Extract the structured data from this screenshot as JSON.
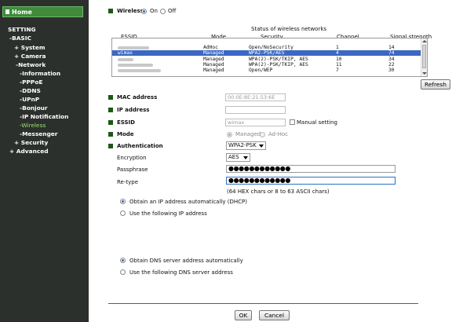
{
  "sidebar": {
    "home": "Home",
    "items": [
      {
        "label": "SETTING",
        "active": false
      },
      {
        "label": "-BASIC",
        "active": false
      },
      {
        "label": "+ System",
        "active": false
      },
      {
        "label": "+ Camera",
        "active": false
      },
      {
        "label": "-Network",
        "active": false
      },
      {
        "label": "-Information",
        "active": false
      },
      {
        "label": "-PPPoE",
        "active": false
      },
      {
        "label": "-DDNS",
        "active": false
      },
      {
        "label": "-UPnP",
        "active": false
      },
      {
        "label": "-Bonjour",
        "active": false
      },
      {
        "label": "-IP Notification",
        "active": false
      },
      {
        "label": "-Wireless",
        "active": true
      },
      {
        "label": "-Messenger",
        "active": false
      },
      {
        "label": "+ Security",
        "active": false
      },
      {
        "label": "+ Advanced",
        "active": false
      }
    ]
  },
  "wireless": {
    "label": "Wireless",
    "on_label": "On",
    "off_label": "Off",
    "state": "On"
  },
  "networks": {
    "caption": "Status of wireless networks",
    "columns": [
      "ESSID",
      "Mode",
      "Security",
      "Channel",
      "Signal strength"
    ],
    "rows": [
      {
        "essid": "",
        "mode": "AdHoc",
        "security": "Open/NoSecurity",
        "channel": "1",
        "signal": "14",
        "selected": false
      },
      {
        "essid": "wimax",
        "mode": "Managed",
        "security": "WPA2-PSK/AES",
        "channel": "4",
        "signal": "74",
        "selected": true
      },
      {
        "essid": "",
        "mode": "Managed",
        "security": "WPA(2)-PSK/TKIP, AES",
        "channel": "10",
        "signal": "34",
        "selected": false
      },
      {
        "essid": "",
        "mode": "Managed",
        "security": "WPA(2)-PSK/TKIP, AES",
        "channel": "11",
        "signal": "22",
        "selected": false
      },
      {
        "essid": "",
        "mode": "Managed",
        "security": "Open/WEP",
        "channel": "7",
        "signal": "30",
        "selected": false
      }
    ],
    "refresh_label": "Refresh"
  },
  "fields": {
    "mac_label": "MAC address",
    "mac_value": "00:0E:8E:21:53:6E",
    "ip_label": "IP address",
    "ip_value": "",
    "essid_label": "ESSID",
    "essid_value": "wimax",
    "manual_label": "Manual setting",
    "mode_label": "Mode",
    "mode_managed": "Managed",
    "mode_adhoc": "Ad-Hoc",
    "auth_label": "Authentication",
    "auth_value": "WPA2-PSK",
    "enc_label": "Encryption",
    "enc_value": "AES",
    "pass_label": "Passphrase",
    "pass_value": "●●●●●●●●●●●●",
    "retype_label": "Re-type",
    "retype_value": "●●●●●●●●●●●●",
    "hint": "(64 HEX chars or 8 to 63 ASCII chars)"
  },
  "ip_options": {
    "dhcp": "Obtain an IP address automatically (DHCP)",
    "static": "Use the following IP address",
    "dns_auto": "Obtain DNS server address automatically",
    "dns_manual": "Use the following DNS server address"
  },
  "actions": {
    "ok": "OK",
    "cancel": "Cancel"
  }
}
